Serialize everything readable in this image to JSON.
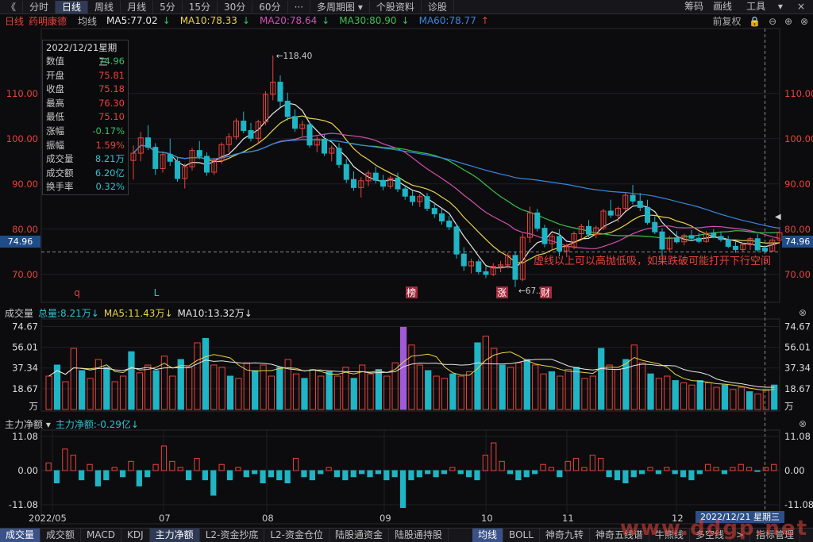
{
  "toolbar": {
    "back": "《",
    "items": [
      "分时",
      "日线",
      "周线",
      "月线",
      "5分",
      "15分",
      "30分",
      "60分",
      "···",
      "多周期图",
      "个股资料",
      "诊股"
    ],
    "active": 1,
    "right": [
      "筹码",
      "画线",
      "工具",
      "×"
    ]
  },
  "ma_bar": {
    "period": "日线",
    "stock": "药明康德",
    "avg_label": "均线",
    "ma5": "MA5:77.02",
    "ma10": "MA10:78.33",
    "ma20": "MA20:78.64",
    "ma30": "MA30:80.90",
    "ma60": "MA60:78.77",
    "right_label": "前复权",
    "colors": {
      "ma5": "#e6e6e6",
      "ma10": "#e8d34a",
      "ma20": "#d54fb2",
      "ma30": "#39c24b",
      "ma60": "#3a86e0"
    }
  },
  "info_box": {
    "date": "2022/12/21",
    "weekday": "星期三",
    "rows": [
      {
        "k": "数值",
        "v": "74.96",
        "c": "#31c06a"
      },
      {
        "k": "开盘",
        "v": "75.81",
        "c": "#e8433b"
      },
      {
        "k": "收盘",
        "v": "75.18",
        "c": "#e8433b"
      },
      {
        "k": "最高",
        "v": "76.30",
        "c": "#e8433b"
      },
      {
        "k": "最低",
        "v": "75.10",
        "c": "#e8433b"
      },
      {
        "k": "涨幅",
        "v": "-0.17%",
        "c": "#31c06a"
      },
      {
        "k": "振幅",
        "v": "1.59%",
        "c": "#e8433b"
      },
      {
        "k": "成交量",
        "v": "8.21万",
        "c": "#31c0d0"
      },
      {
        "k": "成交额",
        "v": "6.20亿",
        "c": "#31c0d0"
      },
      {
        "k": "换手率",
        "v": "0.32%",
        "c": "#31c0d0"
      }
    ]
  },
  "crosshair_price": "74.96",
  "annotation": "虚线以上可以高抛低吸，如果跌破可能打开下行空间",
  "price_labels": {
    "high": "118.40",
    "low": "67.20"
  },
  "event_marks": [
    {
      "t": "q",
      "c": "#e8433b"
    },
    {
      "t": "L",
      "c": "#31c0c0"
    },
    {
      "t": "榜",
      "c": "#ffffff",
      "bg": "#a8273b"
    },
    {
      "t": "涨",
      "c": "#ffffff",
      "bg": "#a8273b"
    },
    {
      "t": "财",
      "c": "#ffffff",
      "bg": "#a8273b"
    }
  ],
  "volume_bar": {
    "title": "成交量",
    "total": "总量:8.21万↓",
    "ma5": "MA5:11.43万↓",
    "ma10": "MA10:13.32万↓",
    "axis": [
      "74.67",
      "56.01",
      "37.34",
      "18.67",
      "万"
    ]
  },
  "flow_bar": {
    "title": "主力净额 ▾",
    "value": "主力净额:-0.29亿↓",
    "axis": [
      "11.08",
      "0.00",
      "-11.08"
    ]
  },
  "date_axis": [
    "2022/05",
    "07",
    "08",
    "09",
    "10",
    "11",
    "12"
  ],
  "date_label": "2022/12/21 星期三",
  "bottom_tabs": [
    "成交量",
    "成交额",
    "MACD",
    "KDJ",
    "主力净额",
    "L2-资金抄底",
    "L2-资金仓位",
    "陆股通资金",
    "陆股通持股",
    "均线",
    "BOLL",
    "神奇九转",
    "神奇五线谱",
    "牛熊线",
    "多空线",
    ">",
    "指标管理"
  ],
  "watermark": "www.ddgp.net",
  "chart_data": {
    "type": "candlestick",
    "price_axis": {
      "ticks": [
        70,
        80,
        90,
        100,
        110
      ],
      "ylim": [
        64,
        124
      ]
    },
    "ohlc": [
      [
        95.2,
        98.5,
        91.0,
        96.8
      ],
      [
        96.8,
        101.5,
        95.0,
        100.2
      ],
      [
        100.2,
        103.0,
        97.5,
        98.1
      ],
      [
        98.1,
        99.0,
        92.0,
        93.4
      ],
      [
        93.4,
        97.0,
        92.5,
        96.5
      ],
      [
        96.5,
        100.0,
        94.0,
        95.0
      ],
      [
        95.0,
        96.0,
        90.5,
        91.2
      ],
      [
        91.2,
        94.5,
        89.0,
        93.8
      ],
      [
        93.8,
        98.0,
        93.0,
        97.4
      ],
      [
        97.4,
        99.5,
        95.5,
        96.1
      ],
      [
        96.1,
        97.0,
        91.8,
        92.6
      ],
      [
        92.6,
        95.8,
        92.0,
        95.2
      ],
      [
        95.2,
        99.2,
        94.5,
        98.7
      ],
      [
        98.7,
        101.2,
        97.0,
        100.4
      ],
      [
        100.4,
        104.5,
        99.8,
        103.9
      ],
      [
        103.9,
        106.0,
        101.2,
        101.8
      ],
      [
        101.8,
        103.5,
        99.4,
        100.1
      ],
      [
        100.1,
        104.2,
        99.0,
        103.7
      ],
      [
        103.7,
        110.5,
        103.0,
        109.8
      ],
      [
        109.8,
        118.4,
        108.5,
        112.5
      ],
      [
        112.5,
        114.0,
        107.0,
        108.3
      ],
      [
        108.3,
        110.2,
        104.0,
        104.9
      ],
      [
        104.9,
        106.5,
        101.5,
        102.3
      ],
      [
        102.3,
        104.0,
        100.5,
        103.1
      ],
      [
        103.1,
        103.8,
        98.0,
        98.6
      ],
      [
        98.6,
        100.5,
        97.0,
        99.9
      ],
      [
        99.9,
        101.0,
        96.2,
        96.8
      ],
      [
        96.8,
        98.5,
        95.0,
        97.9
      ],
      [
        97.9,
        99.0,
        93.5,
        94.3
      ],
      [
        94.3,
        95.5,
        90.2,
        91.0
      ],
      [
        91.0,
        92.8,
        88.5,
        89.2
      ],
      [
        89.2,
        91.5,
        87.0,
        90.7
      ],
      [
        90.7,
        93.0,
        89.5,
        92.4
      ],
      [
        92.4,
        93.8,
        90.1,
        90.8
      ],
      [
        90.8,
        92.0,
        88.6,
        89.5
      ],
      [
        89.5,
        91.8,
        88.9,
        91.3
      ],
      [
        91.3,
        92.5,
        88.2,
        88.9
      ],
      [
        88.9,
        89.8,
        86.5,
        87.3
      ],
      [
        87.3,
        88.5,
        85.2,
        86.1
      ],
      [
        86.1,
        87.8,
        84.9,
        87.2
      ],
      [
        87.2,
        88.0,
        84.0,
        84.6
      ],
      [
        84.6,
        85.9,
        82.5,
        83.4
      ],
      [
        83.4,
        84.5,
        81.0,
        81.8
      ],
      [
        81.8,
        82.9,
        79.8,
        80.5
      ],
      [
        80.5,
        81.2,
        73.5,
        74.5
      ],
      [
        74.5,
        76.0,
        70.8,
        71.9
      ],
      [
        71.9,
        73.5,
        70.2,
        72.8
      ],
      [
        72.8,
        73.4,
        70.0,
        70.6
      ],
      [
        70.6,
        71.8,
        69.2,
        70.0
      ],
      [
        70.0,
        72.5,
        69.6,
        71.8
      ],
      [
        71.8,
        73.0,
        70.5,
        72.1
      ],
      [
        72.1,
        74.8,
        71.3,
        74.2
      ],
      [
        74.2,
        75.0,
        67.2,
        68.9
      ],
      [
        68.9,
        79.0,
        68.5,
        78.2
      ],
      [
        78.2,
        85.0,
        77.0,
        83.6
      ],
      [
        83.6,
        84.5,
        79.5,
        80.2
      ],
      [
        80.2,
        81.0,
        76.0,
        76.8
      ],
      [
        76.8,
        78.9,
        75.5,
        78.4
      ],
      [
        78.4,
        80.0,
        74.0,
        75.2
      ],
      [
        75.2,
        76.8,
        73.8,
        76.1
      ],
      [
        76.1,
        79.5,
        75.6,
        79.0
      ],
      [
        79.0,
        81.2,
        77.8,
        80.6
      ],
      [
        80.6,
        82.0,
        78.2,
        78.9
      ],
      [
        78.9,
        80.8,
        78.0,
        80.3
      ],
      [
        80.3,
        84.5,
        79.8,
        84.0
      ],
      [
        84.0,
        86.5,
        82.5,
        83.1
      ],
      [
        83.1,
        85.0,
        81.5,
        84.6
      ],
      [
        84.6,
        88.2,
        84.0,
        87.5
      ],
      [
        87.5,
        89.8,
        85.5,
        86.2
      ],
      [
        86.2,
        88.0,
        84.0,
        84.8
      ],
      [
        84.8,
        86.5,
        81.0,
        81.5
      ],
      [
        81.5,
        82.8,
        78.9,
        79.4
      ],
      [
        79.4,
        80.2,
        74.0,
        75.6
      ],
      [
        75.6,
        78.5,
        75.0,
        78.1
      ],
      [
        78.1,
        79.6,
        76.8,
        77.2
      ],
      [
        77.2,
        79.0,
        76.4,
        78.6
      ],
      [
        78.6,
        79.8,
        77.5,
        78.0
      ],
      [
        78.0,
        79.2,
        76.9,
        77.3
      ],
      [
        77.3,
        79.6,
        77.0,
        79.1
      ],
      [
        79.1,
        80.0,
        78.0,
        78.4
      ],
      [
        78.4,
        79.5,
        77.2,
        77.7
      ],
      [
        77.7,
        78.5,
        75.8,
        76.2
      ],
      [
        76.2,
        77.4,
        74.8,
        75.5
      ],
      [
        75.5,
        77.0,
        74.9,
        76.6
      ],
      [
        76.6,
        78.2,
        75.4,
        77.9
      ],
      [
        77.9,
        79.0,
        75.0,
        75.4
      ],
      [
        75.81,
        76.3,
        75.1,
        75.18
      ],
      [
        75.2,
        78.0,
        74.9,
        77.6
      ],
      [
        77.6,
        80.5,
        76.9,
        79.2
      ]
    ],
    "volume_axis": {
      "ticks": [
        18.67,
        37.34,
        56.01,
        74.67
      ],
      "unit": "万"
    },
    "volume": [
      30,
      40,
      25,
      55,
      35,
      28,
      45,
      38,
      25,
      30,
      52,
      33,
      40,
      35,
      48,
      30,
      45,
      38,
      60,
      64,
      40,
      38,
      30,
      28,
      42,
      35,
      40,
      30,
      38,
      45,
      32,
      28,
      36,
      30,
      34,
      30,
      38,
      28,
      40,
      32,
      36,
      30,
      42,
      74,
      58,
      40,
      35,
      30,
      28,
      32,
      30,
      34,
      60,
      66,
      55,
      40,
      38,
      42,
      45,
      40,
      32,
      34,
      30,
      36,
      38,
      28,
      30,
      55,
      40,
      36,
      45,
      58,
      42,
      32,
      28,
      30,
      26,
      24,
      22,
      26,
      24,
      20,
      22,
      18,
      20,
      16,
      14,
      18,
      22
    ],
    "main_flow_axis": {
      "ticks": [
        -11.08,
        0,
        11.08
      ],
      "unit": "亿"
    },
    "main_flow": [
      2.5,
      -4,
      7,
      5,
      -3,
      2,
      -5,
      -3,
      1,
      -2,
      3,
      -5,
      -2,
      2,
      8,
      3,
      1,
      -3,
      4,
      -3,
      -8,
      2,
      -3,
      1,
      -2,
      -1,
      -4,
      -2,
      -3,
      -4,
      4,
      -2,
      -3,
      -1,
      1,
      -2,
      -3,
      -2,
      -1,
      -2,
      -1,
      -3,
      -2,
      -12,
      -3,
      -2,
      -1,
      -2,
      -1,
      1,
      -1,
      -2,
      -3,
      5,
      9,
      3,
      -1,
      -3,
      -2,
      -1,
      2,
      1,
      -2,
      3,
      4,
      1,
      5,
      4,
      -2,
      -3,
      -4,
      -2,
      -1,
      1,
      -1,
      1,
      -1,
      -2,
      -3,
      -1,
      2,
      1,
      -1,
      1,
      2,
      1,
      -0.29,
      1,
      2
    ]
  }
}
